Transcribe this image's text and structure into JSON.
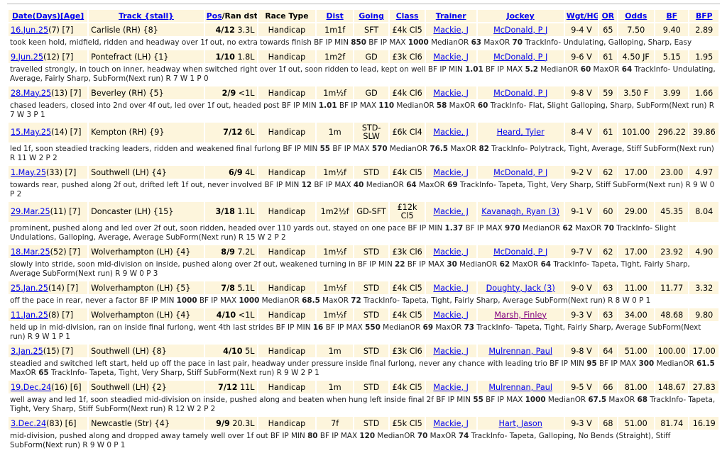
{
  "headers": {
    "date": "Date(Days)[Age]",
    "track": "Track {stall}",
    "pos": "Pos",
    "ran_dst": "/Ran dst",
    "race_type": "Race Type",
    "dist": "Dist",
    "going": "Going",
    "class": "Class",
    "trainer": "Trainer",
    "jockey": "Jockey",
    "wgt": "Wgt/HG",
    "or": "OR",
    "odds": "Odds",
    "bf": "BF",
    "bfp": "BFP"
  },
  "runs": [
    {
      "date": "16.Jun.25",
      "days_age": "(7) [7]",
      "track": "Carlisle (RH) {8}",
      "pos": "4/12",
      "dst": "3.3L",
      "race_type": "Handicap",
      "dist": "1m1f",
      "going": "SFT",
      "class": "£4k Cl5",
      "trainer": "Mackie, J",
      "jockey": "McDonald, P J",
      "jockey_purple": false,
      "wgt": "9-4 V",
      "or": "65",
      "odds": "7.50",
      "bf": "9.40",
      "bfp": "2.89",
      "comment_parts": [
        [
          "took keen hold, midfield, ridden and headway over 1f out, no extra towards finish BF IP MIN ",
          false
        ],
        [
          "850",
          true
        ],
        [
          " BF IP MAX ",
          false
        ],
        [
          "1000",
          true
        ],
        [
          " MedianOR ",
          false
        ],
        [
          "63",
          true
        ],
        [
          " MaxOR ",
          false
        ],
        [
          "70",
          true
        ],
        [
          " TrackInfo- Undulating, Galloping, Sharp, Easy",
          false
        ]
      ]
    },
    {
      "date": "9.Jun.25",
      "days_age": "(12) [7]",
      "track": "Pontefract (LH) {1}",
      "pos": "1/10",
      "dst": "1.8L",
      "race_type": "Handicap",
      "dist": "1m2f",
      "going": "GD",
      "class": "£3k Cl6",
      "trainer": "Mackie, J",
      "jockey": "McDonald, P J",
      "jockey_purple": false,
      "wgt": "9-6 V",
      "or": "61",
      "odds": "4.50 JF",
      "bf": "5.15",
      "bfp": "1.95",
      "comment_parts": [
        [
          "travelled strongly, in touch on inner, headway when switched right over 1f out, soon ridden to lead, kept on well BF IP MIN ",
          false
        ],
        [
          "1.01",
          true
        ],
        [
          " BF IP MAX ",
          false
        ],
        [
          "5.2",
          true
        ],
        [
          " MedianOR ",
          false
        ],
        [
          "60",
          true
        ],
        [
          " MaxOR ",
          false
        ],
        [
          "64",
          true
        ],
        [
          " TrackInfo- Undulating, Average, Fairly Sharp, SubForm(Next run) R 7 W 1 P 0",
          false
        ]
      ]
    },
    {
      "date": "28.May.25",
      "days_age": "(13) [7]",
      "track": "Beverley (RH) {5}",
      "pos": "2/9",
      "dst": "<1L",
      "race_type": "Handicap",
      "dist": "1m½f",
      "going": "GD",
      "class": "£4k Cl6",
      "trainer": "Mackie, J",
      "jockey": "McDonald, P J",
      "jockey_purple": false,
      "wgt": "9-8 V",
      "or": "59",
      "odds": "3.50 F",
      "bf": "3.99",
      "bfp": "1.66",
      "comment_parts": [
        [
          "chased leaders, closed into 2nd over 4f out, led over 1f out, headed post BF IP MIN ",
          false
        ],
        [
          "1.01",
          true
        ],
        [
          " BF IP MAX ",
          false
        ],
        [
          "110",
          true
        ],
        [
          " MedianOR ",
          false
        ],
        [
          "58",
          true
        ],
        [
          " MaxOR ",
          false
        ],
        [
          "60",
          true
        ],
        [
          " TrackInfo- Flat, Slight Galloping, Sharp, SubForm(Next run) R 7 W 3 P 1",
          false
        ]
      ]
    },
    {
      "date": "15.May.25",
      "days_age": "(14) [7]",
      "track": "Kempton (RH) {9}",
      "pos": "7/12",
      "dst": "6L",
      "race_type": "Handicap",
      "dist": "1m",
      "going": "STD-SLW",
      "class": "£6k Cl4",
      "trainer": "Mackie, J",
      "jockey": "Heard, Tyler",
      "jockey_purple": false,
      "wgt": "8-4 V",
      "or": "61",
      "odds": "101.00",
      "bf": "296.22",
      "bfp": "39.86",
      "comment_parts": [
        [
          "led 1f, soon steadied tracking leaders, ridden and weakened final furlong BF IP MIN ",
          false
        ],
        [
          "55",
          true
        ],
        [
          " BF IP MAX ",
          false
        ],
        [
          "570",
          true
        ],
        [
          " MedianOR ",
          false
        ],
        [
          "76.5",
          true
        ],
        [
          " MaxOR ",
          false
        ],
        [
          "82",
          true
        ],
        [
          " TrackInfo- Polytrack, Tight, Average, Stiff SubForm(Next run) R 11 W 2 P 2",
          false
        ]
      ]
    },
    {
      "date": "1.May.25",
      "days_age": "(33) [7]",
      "track": "Southwell (LH) {4}",
      "pos": "6/9",
      "dst": "4L",
      "race_type": "Handicap",
      "dist": "1m½f",
      "going": "STD",
      "class": "£4k Cl5",
      "trainer": "Mackie, J",
      "jockey": "McDonald, P J",
      "jockey_purple": false,
      "wgt": "9-2 V",
      "or": "62",
      "odds": "17.00",
      "bf": "23.00",
      "bfp": "4.97",
      "comment_parts": [
        [
          "towards rear, pushed along 2f out, drifted left 1f out, never involved BF IP MIN ",
          false
        ],
        [
          "12",
          true
        ],
        [
          " BF IP MAX ",
          false
        ],
        [
          "40",
          true
        ],
        [
          " MedianOR ",
          false
        ],
        [
          "64",
          true
        ],
        [
          " MaxOR ",
          false
        ],
        [
          "69",
          true
        ],
        [
          " TrackInfo- Tapeta, Tight, Very Sharp, Stiff SubForm(Next run) R 9 W 0 P 2",
          false
        ]
      ]
    },
    {
      "date": "29.Mar.25",
      "days_age": "(11) [7]",
      "track": "Doncaster (LH) {15}",
      "pos": "3/18",
      "dst": "1.1L",
      "race_type": "Handicap",
      "dist": "1m2½f",
      "going": "GD-SFT",
      "class": "£12k Cl5",
      "trainer": "Mackie, J",
      "jockey": "Kavanagh, Ryan (3)",
      "jockey_purple": false,
      "wgt": "9-1 V",
      "or": "60",
      "odds": "29.00",
      "bf": "45.35",
      "bfp": "8.04",
      "comment_parts": [
        [
          "prominent, pushed along and led over 2f out, soon ridden, headed over 110 yards out, stayed on one pace BF IP MIN ",
          false
        ],
        [
          "1.37",
          true
        ],
        [
          " BF IP MAX ",
          false
        ],
        [
          "970",
          true
        ],
        [
          " MedianOR ",
          false
        ],
        [
          "62",
          true
        ],
        [
          " MaxOR ",
          false
        ],
        [
          "70",
          true
        ],
        [
          " TrackInfo- Slight Undulations, Galloping, Average, Average SubForm(Next run) R 15 W 2 P 2",
          false
        ]
      ]
    },
    {
      "date": "18.Mar.25",
      "days_age": "(52) [7]",
      "track": "Wolverhampton (LH) {4}",
      "pos": "8/9",
      "dst": "7.2L",
      "race_type": "Handicap",
      "dist": "1m½f",
      "going": "STD",
      "class": "£3k Cl6",
      "trainer": "Mackie, J",
      "jockey": "McDonald, P J",
      "jockey_purple": false,
      "wgt": "9-7 V",
      "or": "62",
      "odds": "17.00",
      "bf": "23.92",
      "bfp": "4.90",
      "comment_parts": [
        [
          "slowly into stride, soon mid-division on inside, pushed along over 2f out, weakened turning in BF IP MIN ",
          false
        ],
        [
          "22",
          true
        ],
        [
          " BF IP MAX ",
          false
        ],
        [
          "30",
          true
        ],
        [
          " MedianOR ",
          false
        ],
        [
          "62",
          true
        ],
        [
          " MaxOR ",
          false
        ],
        [
          "64",
          true
        ],
        [
          " TrackInfo- Tapeta, Tight, Fairly Sharp, Average SubForm(Next run) R 9 W 0 P 3",
          false
        ]
      ]
    },
    {
      "date": "25.Jan.25",
      "days_age": "(14) [7]",
      "track": "Wolverhampton (LH) {5}",
      "pos": "7/8",
      "dst": "5.1L",
      "race_type": "Handicap",
      "dist": "1m½f",
      "going": "STD",
      "class": "£4k Cl5",
      "trainer": "Mackie, J",
      "jockey": "Doughty, Jack (3)",
      "jockey_purple": false,
      "wgt": "9-0 V",
      "or": "63",
      "odds": "11.00",
      "bf": "11.77",
      "bfp": "3.32",
      "comment_parts": [
        [
          "off the pace in rear, never a factor BF IP MIN ",
          false
        ],
        [
          "1000",
          true
        ],
        [
          " BF IP MAX ",
          false
        ],
        [
          "1000",
          true
        ],
        [
          " MedianOR ",
          false
        ],
        [
          "68.5",
          true
        ],
        [
          " MaxOR ",
          false
        ],
        [
          "72",
          true
        ],
        [
          " TrackInfo- Tapeta, Tight, Fairly Sharp, Average SubForm(Next run) R 8 W 0 P 1",
          false
        ]
      ]
    },
    {
      "date": "11.Jan.25",
      "days_age": "(8) [7]",
      "track": "Wolverhampton (LH) {4}",
      "pos": "4/10",
      "dst": "<1L",
      "race_type": "Handicap",
      "dist": "1m½f",
      "going": "STD",
      "class": "£4k Cl5",
      "trainer": "Mackie, J",
      "jockey": "Marsh, Finley",
      "jockey_purple": true,
      "wgt": "9-3 V",
      "or": "63",
      "odds": "34.00",
      "bf": "48.68",
      "bfp": "9.80",
      "comment_parts": [
        [
          "held up in mid-division, ran on inside final furlong, went 4th last strides BF IP MIN ",
          false
        ],
        [
          "16",
          true
        ],
        [
          " BF IP MAX ",
          false
        ],
        [
          "550",
          true
        ],
        [
          " MedianOR ",
          false
        ],
        [
          "69",
          true
        ],
        [
          " MaxOR ",
          false
        ],
        [
          "73",
          true
        ],
        [
          " TrackInfo- Tapeta, Tight, Fairly Sharp, Average SubForm(Next run) R 9 W 1 P 1",
          false
        ]
      ]
    },
    {
      "date": "3.Jan.25",
      "days_age": "(15) [7]",
      "track": "Southwell (LH) {8}",
      "pos": "4/10",
      "dst": "5L",
      "race_type": "Handicap",
      "dist": "1m",
      "going": "STD",
      "class": "£3k Cl6",
      "trainer": "Mackie, J",
      "jockey": "Mulrennan, Paul",
      "jockey_purple": false,
      "wgt": "9-8 V",
      "or": "64",
      "odds": "51.00",
      "bf": "100.00",
      "bfp": "17.00",
      "comment_parts": [
        [
          "steadied and switched left start, held up off the pace in last pair, headway under pressure inside final furlong, never any chance with leading trio BF IP MIN ",
          false
        ],
        [
          "95",
          true
        ],
        [
          " BF IP MAX ",
          false
        ],
        [
          "300",
          true
        ],
        [
          " MedianOR ",
          false
        ],
        [
          "61.5",
          true
        ],
        [
          " MaxOR ",
          false
        ],
        [
          "65",
          true
        ],
        [
          " TrackInfo- Tapeta, Tight, Very Sharp, Stiff SubForm(Next run) R 9 W 2 P 1",
          false
        ]
      ]
    },
    {
      "date": "19.Dec.24",
      "days_age": "(16) [6]",
      "track": "Southwell (LH) {2}",
      "pos": "7/12",
      "dst": "11L",
      "race_type": "Handicap",
      "dist": "1m",
      "going": "STD",
      "class": "£4k Cl5",
      "trainer": "Mackie, J",
      "jockey": "Mulrennan, Paul",
      "jockey_purple": false,
      "wgt": "9-5 V",
      "or": "66",
      "odds": "81.00",
      "bf": "148.67",
      "bfp": "27.83",
      "comment_parts": [
        [
          "well away and led 1f, soon steadied mid-division on inside, pushed along and beaten when hung left inside final 2f BF IP MIN ",
          false
        ],
        [
          "55",
          true
        ],
        [
          " BF IP MAX ",
          false
        ],
        [
          "1000",
          true
        ],
        [
          " MedianOR ",
          false
        ],
        [
          "67.5",
          true
        ],
        [
          " MaxOR ",
          false
        ],
        [
          "68",
          true
        ],
        [
          " TrackInfo- Tapeta, Tight, Very Sharp, Stiff SubForm(Next run) R 12 W 2 P 2",
          false
        ]
      ]
    },
    {
      "date": "3.Dec.24",
      "days_age": "(83) [6]",
      "track": "Newcastle (Str) {4}",
      "pos": "9/9",
      "dst": "20.3L",
      "race_type": "Handicap",
      "dist": "7f",
      "going": "STD",
      "class": "£5k Cl5",
      "trainer": "Mackie, J",
      "jockey": "Hart, Jason",
      "jockey_purple": false,
      "wgt": "9-3 V",
      "or": "68",
      "odds": "51.00",
      "bf": "81.74",
      "bfp": "16.19",
      "comment_parts": [
        [
          "mid-division, pushed along and dropped away tamely well over 1f out BF IP MIN ",
          false
        ],
        [
          "80",
          true
        ],
        [
          " BF IP MAX ",
          false
        ],
        [
          "120",
          true
        ],
        [
          " MedianOR ",
          false
        ],
        [
          "70",
          true
        ],
        [
          " MaxOR ",
          false
        ],
        [
          "74",
          true
        ],
        [
          " TrackInfo- Tapeta, Galloping, No Bends (Straight), Stiff SubForm(Next run) R 9 W 0 P 1",
          false
        ]
      ]
    }
  ]
}
